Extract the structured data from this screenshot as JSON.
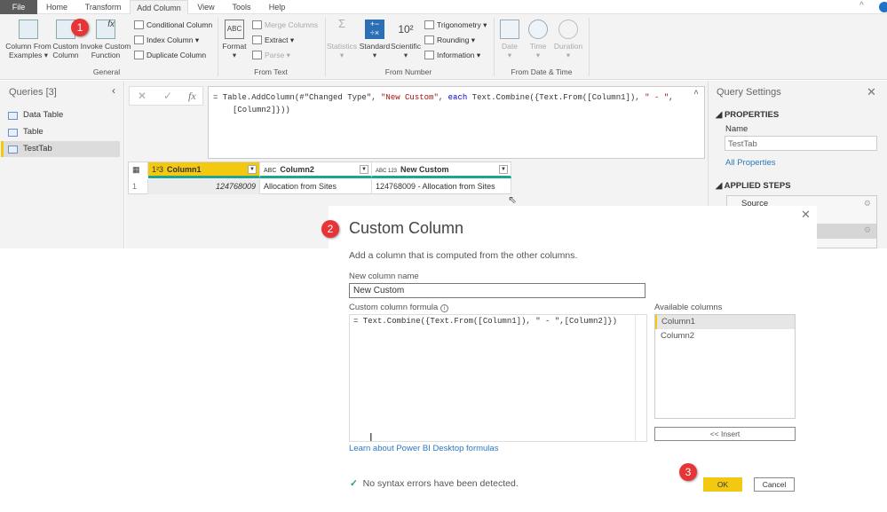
{
  "tabs": [
    "File",
    "Home",
    "Transform",
    "Add Column",
    "View",
    "Tools",
    "Help"
  ],
  "ribbon": {
    "general": {
      "col_from_examples": "Column From Examples",
      "custom_column": "Custom Column",
      "invoke_custom_function": "Invoke Custom Function",
      "conditional": "Conditional Column",
      "index": "Index Column",
      "duplicate": "Duplicate Column",
      "group": "General"
    },
    "from_text": {
      "format": "Format",
      "merge": "Merge Columns",
      "extract": "Extract",
      "parse": "Parse",
      "group": "From Text"
    },
    "from_number": {
      "statistics": "Statistics",
      "standard": "Standard",
      "scientific": "Scientific",
      "trig": "Trigonometry",
      "rounding": "Rounding",
      "information": "Information",
      "group": "From Number",
      "sci_glyph": "10²"
    },
    "from_date": {
      "date": "Date",
      "time": "Time",
      "duration": "Duration",
      "group": "From Date & Time"
    }
  },
  "badges": [
    "1",
    "2",
    "3"
  ],
  "queries": {
    "title": "Queries [3]",
    "items": [
      "Data Table",
      "Table",
      "TestTab"
    ],
    "selected": "TestTab"
  },
  "formula": {
    "line1_a": "= Table.AddColumn(#\"Changed Type\", ",
    "line1_str": "\"New Custom\"",
    "line1_b": ", ",
    "line1_kw": "each",
    "line1_c": " Text.Combine({Text.From([Column1]), ",
    "line1_str2": "\" - \"",
    "line1_d": ",",
    "line2": "[Column2]}))",
    "fx": "fx"
  },
  "grid": {
    "headers": [
      {
        "type": "1²3",
        "name": "Column1"
      },
      {
        "type": "ABC",
        "name": "Column2"
      },
      {
        "type": "ABC 123",
        "name": "New Custom"
      }
    ],
    "rows": [
      {
        "num": "1",
        "cells": [
          "124768009",
          "Allocation from Sites",
          "124768009 - Allocation from Sites"
        ]
      }
    ]
  },
  "settings": {
    "title": "Query Settings",
    "properties": "PROPERTIES",
    "name_label": "Name",
    "name_value": "TestTab",
    "all_properties": "All Properties",
    "applied_steps": "APPLIED STEPS",
    "steps": [
      "Source"
    ]
  },
  "dialog": {
    "title": "Custom Column",
    "subtitle": "Add a column that is computed from the other columns.",
    "name_label": "New column name",
    "name_value": "New Custom",
    "formula_label": "Custom column formula",
    "formula": "= Text.Combine({Text.From([Column1]), \" - \",[Column2]})",
    "available_label": "Available columns",
    "available": [
      "Column1",
      "Column2"
    ],
    "insert": "<< Insert",
    "learn_link": "Learn about Power BI Desktop formulas",
    "status": "No syntax errors have been detected.",
    "ok": "OK",
    "cancel": "Cancel"
  },
  "colors": {
    "accent": "#f2c811",
    "teal": "#1fa58f",
    "badge": "#e63437",
    "link": "#2b79c2"
  }
}
